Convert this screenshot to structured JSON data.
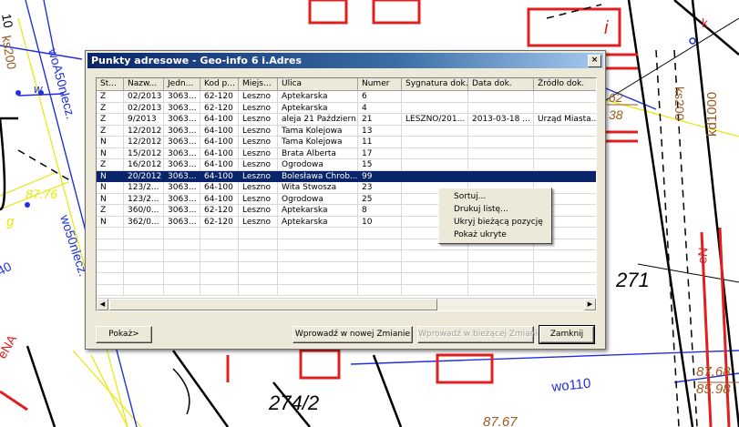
{
  "map": {
    "labels": [
      "10",
      "ks200",
      "w",
      "woA50nlecz.",
      "87.76",
      "g",
      "wo50nlecz.",
      "40",
      "eNA",
      "i",
      "k",
      "62",
      "38",
      "ks200",
      "kd1000",
      "271",
      "eN",
      "274/2",
      "87.68",
      "85.98",
      "wo110",
      "87.67"
    ]
  },
  "dialog": {
    "title": "Punkty adresowe - Geo-info 6 i.Adres",
    "close_label": "×",
    "columns": [
      "St...",
      "Nazw...",
      "Jedn...",
      "Kod p...",
      "Miejs...",
      "Ulica",
      "Numer",
      "Sygnatura dok.",
      "Data dok.",
      "Źródło dok."
    ],
    "rows": [
      [
        "Z",
        "02/2013",
        "3063...",
        "62-120",
        "Leszno",
        "Aptekarska",
        "6",
        "",
        "",
        ""
      ],
      [
        "Z",
        "02/2013",
        "3063...",
        "62-120",
        "Leszno",
        "Aptekarska",
        "4",
        "",
        "",
        ""
      ],
      [
        "Z",
        "9/2013",
        "3063...",
        "64-100",
        "Leszno",
        "aleja 21 Październ...",
        "21",
        "LESZNO/201...",
        "2013-03-18 ...",
        "Urząd Miasta..."
      ],
      [
        "Z",
        "12/2012",
        "3063...",
        "64-100",
        "Leszno",
        "Tama Kolejowa",
        "13",
        "",
        "",
        ""
      ],
      [
        "N",
        "12/2012",
        "3063...",
        "64-100",
        "Leszno",
        "Tama Kolejowa",
        "11",
        "",
        "",
        ""
      ],
      [
        "N",
        "15/2012",
        "3063...",
        "64-100",
        "Leszno",
        "Brata Alberta",
        "17",
        "",
        "",
        ""
      ],
      [
        "Z",
        "16/2012",
        "3063...",
        "64-100",
        "Leszno",
        "Ogrodowa",
        "15",
        "",
        "",
        ""
      ],
      [
        "N",
        "20/2012",
        "3063...",
        "64-100",
        "Leszno",
        "Bolesława Chrob...",
        "99",
        "",
        "",
        ""
      ],
      [
        "N",
        "123/2...",
        "3063...",
        "64-100",
        "Leszno",
        "Wita Stwosza",
        "23",
        "",
        "",
        ""
      ],
      [
        "N",
        "123/2...",
        "3063...",
        "64-100",
        "Leszno",
        "Ogrodowa",
        "25",
        "",
        "",
        ""
      ],
      [
        "Z",
        "360/0...",
        "3063...",
        "62-120",
        "Leszno",
        "Aptekarska",
        "8",
        "",
        "",
        ""
      ],
      [
        "N",
        "362/0...",
        "3063...",
        "62-120",
        "Leszno",
        "Aptekarska",
        "10",
        "",
        "",
        ""
      ]
    ],
    "selected_row": 7,
    "buttons": {
      "show": "Pokaż>",
      "enter_new": "Wprowadź w nowej Zmianie",
      "enter_current": "Wprowadź w bieżącej Zmianie",
      "close": "Zamknij"
    }
  },
  "context_menu": {
    "items": [
      "Sortuj...",
      "Drukuj listę...",
      "Ukryj bieżącą pozycję",
      "Pokaż ukryte"
    ]
  },
  "colors": {
    "title_bar": "#0a246a",
    "selection": "#0a246a",
    "map_red": "#e02020",
    "map_blue": "#2030e0",
    "map_yellow": "#e8e800",
    "map_brown": "#9a5a20"
  }
}
